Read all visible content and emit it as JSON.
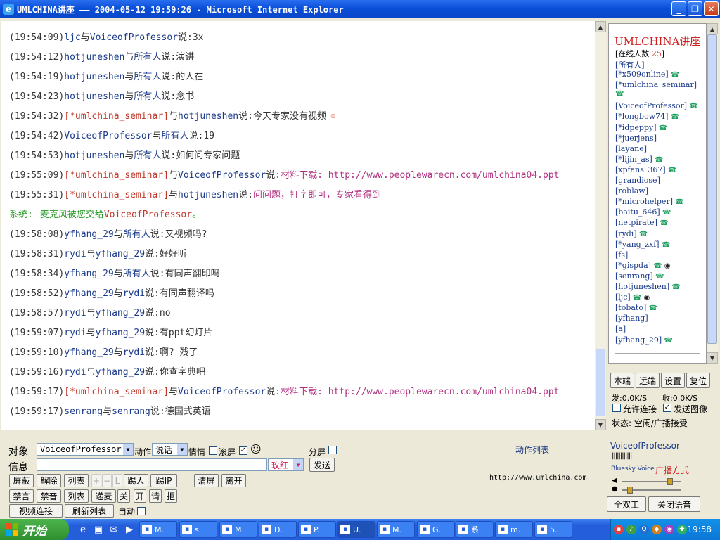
{
  "window": {
    "title": "UMLCHINA讲座 —— 2004-05-12 19:59:26 - Microsoft Internet Explorer",
    "controls": [
      "_",
      "❐",
      "✕"
    ]
  },
  "chat": {
    "lines": [
      {
        "time": "(19:54:09)",
        "from": "ljc",
        "mid": "与",
        "to": "VoiceofProfessor",
        "say": "说:",
        "msg": "3x"
      },
      {
        "time": "(19:54:12)",
        "from": "hotjuneshen",
        "mid": "与",
        "to": "所有人",
        "say": "说:",
        "msg": "演讲"
      },
      {
        "time": "(19:54:19)",
        "from": "hotjuneshen",
        "mid": "与",
        "to": "所有人",
        "say": "说:",
        "msg": "的人在"
      },
      {
        "time": "(19:54:23)",
        "from": "hotjuneshen",
        "mid": "与",
        "to": "所有人",
        "say": "说:",
        "msg": "念书"
      },
      {
        "time": "(19:54:32)",
        "from": "[*umlchina_seminar]",
        "mid": "与",
        "to": "hotjuneshen",
        "say": "说:",
        "msg": "今天专家没有视频"
      },
      {
        "time": "(19:54:42)",
        "from": "VoiceofProfessor",
        "mid": "与",
        "to": "所有人",
        "say": "说:",
        "msg": "19"
      },
      {
        "time": "(19:54:53)",
        "from": "hotjuneshen",
        "mid": "与",
        "to": "所有人",
        "say": "说:",
        "msg": "如何问专家问题"
      },
      {
        "time": "(19:55:09)",
        "from": "[*umlchina_seminar]",
        "mid": "与",
        "to": "VoiceofProfessor",
        "say": "说:",
        "msg": "材料下载: http://www.peoplewarecn.com/umlchina04.ppt"
      },
      {
        "time": "(19:55:31)",
        "from": "[*umlchina_seminar]",
        "mid": "与",
        "to": "hotjuneshen",
        "say": "说:",
        "msg": "问问题，打字即可，专家看得到"
      },
      {
        "time": "(19:58:08)",
        "from": "yfhang_29",
        "mid": "与",
        "to": "所有人",
        "say": "说:",
        "msg": "又视频吗?"
      },
      {
        "time": "(19:58:31)",
        "from": "rydi",
        "mid": "与",
        "to": "yfhang_29",
        "say": "说:",
        "msg": "好好听"
      },
      {
        "time": "(19:58:34)",
        "from": "yfhang_29",
        "mid": "与",
        "to": "所有人",
        "say": "说:",
        "msg": "有同声翻印吗"
      },
      {
        "time": "(19:58:52)",
        "from": "yfhang_29",
        "mid": "与",
        "to": "rydi",
        "say": "说:",
        "msg": "有同声翻译吗"
      },
      {
        "time": "(19:58:57)",
        "from": "rydi",
        "mid": "与",
        "to": "yfhang_29",
        "say": "说:",
        "msg": "no"
      },
      {
        "time": "(19:59:07)",
        "from": "rydi",
        "mid": "与",
        "to": "yfhang_29",
        "say": "说:",
        "msg": "有ppt幻灯片"
      },
      {
        "time": "(19:59:10)",
        "from": "yfhang_29",
        "mid": "与",
        "to": "rydi",
        "say": "说:",
        "msg": "啊? 残了"
      },
      {
        "time": "(19:59:16)",
        "from": "rydi",
        "mid": "与",
        "to": "yfhang_29",
        "say": "说:",
        "msg": "你查字典吧"
      },
      {
        "time": "(19:59:17)",
        "from": "[*umlchina_seminar]",
        "mid": "与",
        "to": "VoiceofProfessor",
        "say": "说:",
        "msg": "材料下载: http://www.peoplewarecn.com/umlchina04.ppt"
      },
      {
        "time": "(19:59:17)",
        "from": "senrang",
        "mid": "与",
        "to": "senrang",
        "say": "说:",
        "msg": "德国式英语"
      }
    ],
    "system": {
      "label": "系统:",
      "text": "麦克风被您交给",
      "name": "VoiceofProfessor",
      "end": "。"
    }
  },
  "users": {
    "title": "UMLCHINA讲座",
    "online_label": "[在线人数",
    "online_count": "25",
    "online_close": "]",
    "list": [
      "[所有人]",
      "[*x509online]",
      "[*umlchina_seminar]",
      "[VoiceofProfessor]",
      "[*longbow74]",
      "[*idpeppy]",
      "[*juerjens]",
      "[layane]",
      "[*lijin_as]",
      "[xpfans_367]",
      "[grandiose]",
      "[roblaw]",
      "[*microhelper]",
      "[baitu_646]",
      "[netpirate]",
      "[rydi]",
      "[*yang_zxf]",
      "[fs]",
      "[*gispda]",
      "[senrang]",
      "[hotjuneshen]",
      "[ljc]",
      "[tobato]",
      "[yfhang]",
      "[a]",
      "[yfhang_29]"
    ]
  },
  "controls": {
    "local": "本端",
    "remote": "远端",
    "settings": "设置",
    "reset": "复位",
    "send_rate": "发:0.0K/S",
    "recv_rate": "收:0.0K/S",
    "allow_connect": "允许连接",
    "send_image": "发送图像",
    "status": "状态: 空闲/广播接受"
  },
  "compose": {
    "target_label": "对象",
    "target_value": "VoiceofProfessor",
    "action_label": "动作",
    "action_value": "说话",
    "mood_label": "情情",
    "scroll_label": "滚屏",
    "split_label": "分屏",
    "action_list": "动作列表",
    "msg_label": "信息",
    "color_value": "玫红",
    "send": "发送",
    "url": "http://www.umlchina.com",
    "row1": [
      "屏蔽",
      "解除",
      "列表",
      "+",
      "−",
      "L",
      "踢人",
      "踢IP",
      "清屏",
      "离开"
    ],
    "row2": [
      "禁言",
      "禁音",
      "列表",
      "递麦",
      "关",
      "开",
      "请",
      "拒"
    ],
    "row3": [
      "视频连接",
      "刷新列表",
      "自动"
    ]
  },
  "voice": {
    "name": "VoiceofProfessor",
    "brand": "Bluesky Voice",
    "mode": "广播方式",
    "full_duplex": "全双工",
    "close_voice": "关闭语音",
    "volume_level": 0.85,
    "mic_level": 0.1
  },
  "taskbar": {
    "start": "开始",
    "items": [
      "M.",
      "s.",
      "M.",
      "D.",
      "P.",
      "U.",
      "M.",
      "G.",
      "系",
      "m.",
      "5."
    ],
    "clock": "19:58"
  }
}
